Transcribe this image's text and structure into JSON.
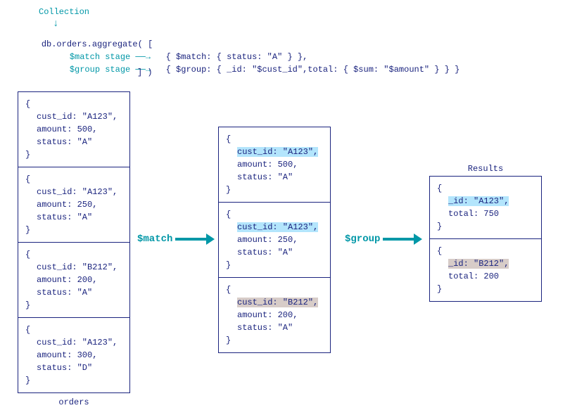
{
  "annotation": {
    "collection_label": "Collection",
    "code_prefix": "db.orders.aggregate( [",
    "match_stage_label": "$match stage",
    "match_stage_code": "{ $match: { status: \"A\" } },",
    "group_stage_label": "$group stage",
    "group_stage_code": "{ $group: { _id: \"$cust_id\",total: { $sum: \"$amount\" } } }",
    "code_suffix": "] )"
  },
  "orders_label": "orders",
  "results_label": "Results",
  "flow": {
    "match": "$match",
    "group": "$group"
  },
  "orders": [
    {
      "cust_id": "cust_id: \"A123\",",
      "amount": "amount: 500,",
      "status": "status: \"A\""
    },
    {
      "cust_id": "cust_id: \"A123\",",
      "amount": "amount: 250,",
      "status": "status: \"A\""
    },
    {
      "cust_id": "cust_id: \"B212\",",
      "amount": "amount: 200,",
      "status": "status: \"A\""
    },
    {
      "cust_id": "cust_id: \"A123\",",
      "amount": "amount: 300,",
      "status": "status: \"D\""
    }
  ],
  "matched": [
    {
      "cust_id": "cust_id: \"A123\",",
      "amount": "amount: 500,",
      "status": "status: \"A\"",
      "hl": "blue"
    },
    {
      "cust_id": "cust_id: \"A123\",",
      "amount": "amount: 250,",
      "status": "status: \"A\"",
      "hl": "blue"
    },
    {
      "cust_id": "cust_id: \"B212\",",
      "amount": "amount: 200,",
      "status": "status: \"A\"",
      "hl": "grey"
    }
  ],
  "results": [
    {
      "id": "_id: \"A123\",",
      "total": "total: 750",
      "hl": "blue"
    },
    {
      "id": "_id: \"B212\",",
      "total": "total: 200",
      "hl": "grey"
    }
  ]
}
